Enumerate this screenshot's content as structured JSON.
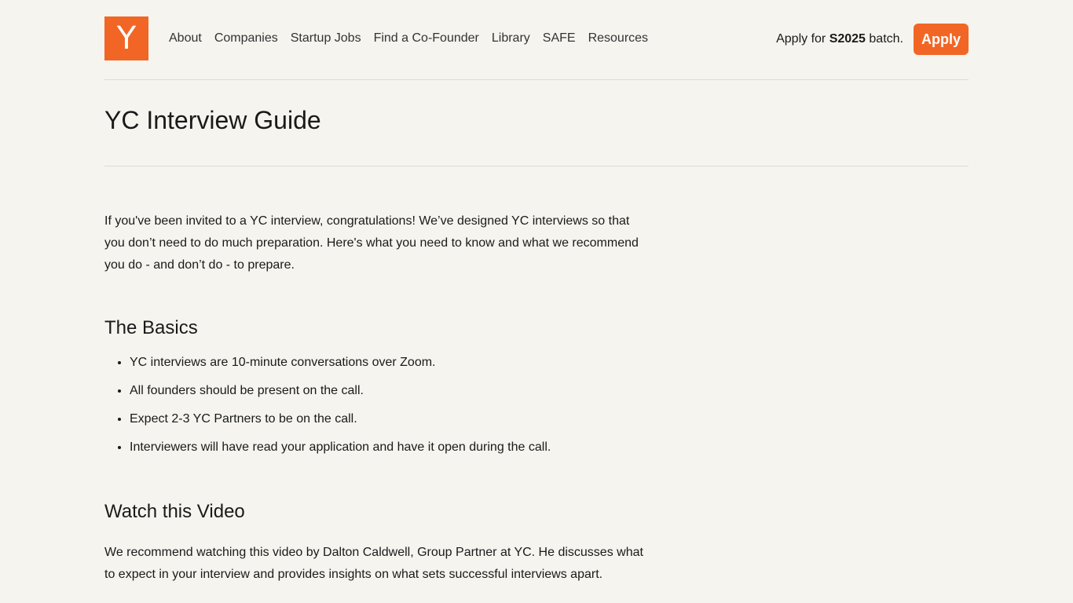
{
  "header": {
    "logo_letter": "Y",
    "nav": [
      "About",
      "Companies",
      "Startup Jobs",
      "Find a Co-Founder",
      "Library",
      "SAFE",
      "Resources"
    ],
    "apply_prefix": "Apply for",
    "apply_batch": "S2025",
    "apply_suffix": "batch.",
    "apply_button": "Apply",
    "accent_color": "#f26625"
  },
  "page": {
    "title": "YC Interview Guide"
  },
  "content": {
    "intro": "If you've been invited to a YC interview, congratulations! We’ve designed YC interviews so that you don’t need to do much preparation. Here's what you need to know and what we recommend you do - and don’t do - to prepare.",
    "basics_heading": "The Basics",
    "basics": [
      "YC interviews are 10-minute conversations over Zoom.",
      "All founders should be present on the call.",
      "Expect 2-3 YC Partners to be on the call.",
      "Interviewers will have read your application and have it open during the call."
    ],
    "video_heading": "Watch this Video",
    "video_intro": "We recommend watching this video by Dalton Caldwell, Group Partner at YC. He discusses what to expect in your interview and provides insights on what sets successful interviews apart."
  }
}
